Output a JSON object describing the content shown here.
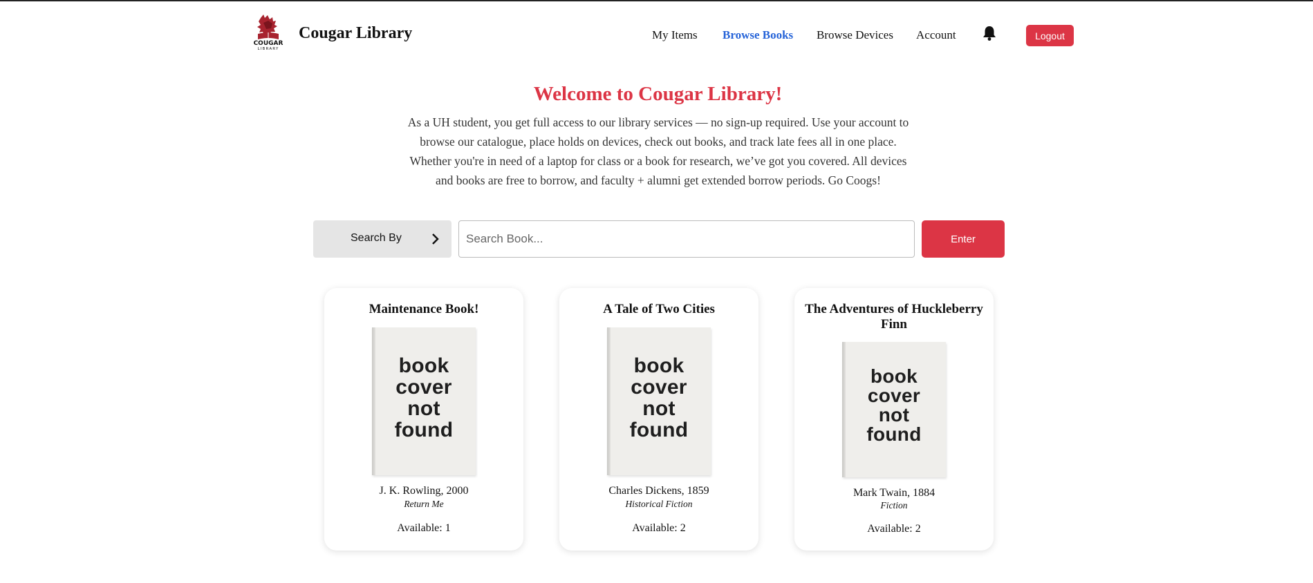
{
  "header": {
    "brand": "Cougar Library",
    "nav": {
      "my_items": "My Items",
      "browse_books": "Browse Books",
      "browse_devices": "Browse Devices",
      "account": "Account"
    },
    "notification_icon": "bell-icon",
    "logout_label": "Logout",
    "active_nav": "Browse Books",
    "accent_color": "#dc3545",
    "active_nav_color": "#2563d8"
  },
  "hero": {
    "title": "Welcome to Cougar Library!",
    "description": "As a UH student, you get full access to our library services — no sign-up required. Use your account to browse our catalogue, place holds on devices, check out books, and track late fees all in one place. Whether you're in need of a laptop for class or a book for research, we’ve got you covered. All devices and books are free to borrow, and faculty + alumni get extended borrow periods. Go Coogs!"
  },
  "search": {
    "search_by_label": "Search By",
    "search_by_icon": "chevron-right-icon",
    "placeholder": "Search Book...",
    "value": "",
    "enter_label": "Enter"
  },
  "books": [
    {
      "title": "Maintenance Book!",
      "cover_text": [
        "book",
        "cover",
        "not",
        "found"
      ],
      "author_year": "J. K. Rowling, 2000",
      "genre": "Return Me",
      "available": "Available: 1"
    },
    {
      "title": "A Tale of Two Cities",
      "cover_text": [
        "book",
        "cover",
        "not",
        "found"
      ],
      "author_year": "Charles Dickens, 1859",
      "genre": "Historical Fiction",
      "available": "Available: 2"
    },
    {
      "title": "The Adventures of Huckleberry Finn",
      "cover_text": [
        "book",
        "cover",
        "not",
        "found"
      ],
      "author_year": "Mark Twain, 1884",
      "genre": "Fiction",
      "available": "Available: 2"
    }
  ]
}
